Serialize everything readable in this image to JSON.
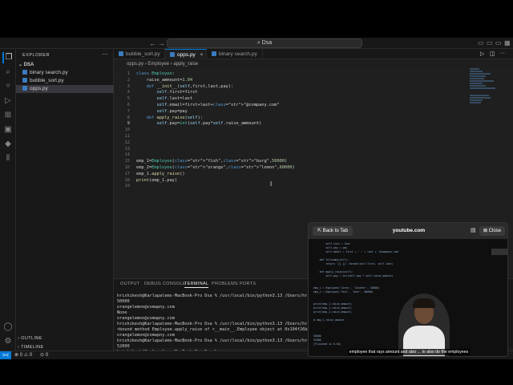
{
  "titlebar": {
    "back": "←",
    "forward": "→",
    "search": "Dsa"
  },
  "sidebar": {
    "title": "EXPLORER",
    "more": "···",
    "folder": "DSA",
    "files": [
      {
        "name": "binary search.py"
      },
      {
        "name": "bubble_sort.py"
      },
      {
        "name": "opps.py"
      }
    ],
    "outline": "OUTLINE",
    "timeline": "TIMELINE"
  },
  "tabs": [
    {
      "label": "bubble_sort.py"
    },
    {
      "label": "opps.py"
    },
    {
      "label": "binary search.py"
    }
  ],
  "breadcrumb": {
    "file": "opps.py",
    "cls": "Employee",
    "method": "apply_raise"
  },
  "editor": {
    "line_numbers": [
      "1",
      "2",
      "3",
      "4",
      "5",
      "6",
      "7",
      "8",
      "9",
      "10",
      "11",
      "12",
      "13",
      "14",
      "15",
      "16",
      "17",
      "18",
      "19"
    ],
    "lines": [
      "class Employee:",
      "    raise_ammount=1.04",
      "    def __init__(self,first,last,pay):",
      "        self.first=first",
      "        self.last=last",
      "        self.email=first+last+\"@company.com\"",
      "        self.pay=pay",
      "    def apply_raise(self):",
      "        self.pay=int(self.pay*self.raise_ammount)",
      "",
      "",
      "",
      "",
      "",
      "emp_1=Employee(\"fish\",\"burg\",50000)",
      "emp_2=Employee(\"orange\",\"lemon\",60000)",
      "emp_1.apply_raise()",
      "print(emp_1.pay)",
      ""
    ]
  },
  "panel": {
    "tabs": [
      "OUTPUT",
      "DEBUG CONSOLE",
      "TERMINAL",
      "PROBLEMS",
      "PORTS"
    ],
    "terminal": [
      "hrishikesh@Karlapalems-MacBook-Pro Dsa % /usr/local/bin/python3.13 /Users/hrish",
      "50000",
      "orangelemon@comapny.com",
      "None",
      "orangelemon@comapny.com",
      "hrishikesh@Karlapalems-MacBook-Pro Dsa % /usr/local/bin/python3.13 /Users/hrish",
      "<bound method Employee.apply_raise of <__main__.Employee object at 0x104f26bab",
      "orangelemon@comapny.com",
      "hrishikesh@Karlapalems-MacBook-Pro Dsa % /usr/local/bin/python3.13 /Users/hrish",
      "52000",
      "hrishikesh@Karlapalems-MacBook-Pro Dsa % ▯"
    ]
  },
  "statusbar": {
    "remote": "><",
    "problems": "⊗ 0 ⚠ 0",
    "ports": "⊙ 0"
  },
  "pip": {
    "back": "Back to Tab",
    "title": "youtube.com",
    "close": "Close",
    "subtitle": "employee that rays amount and also ... to also do the employees"
  }
}
